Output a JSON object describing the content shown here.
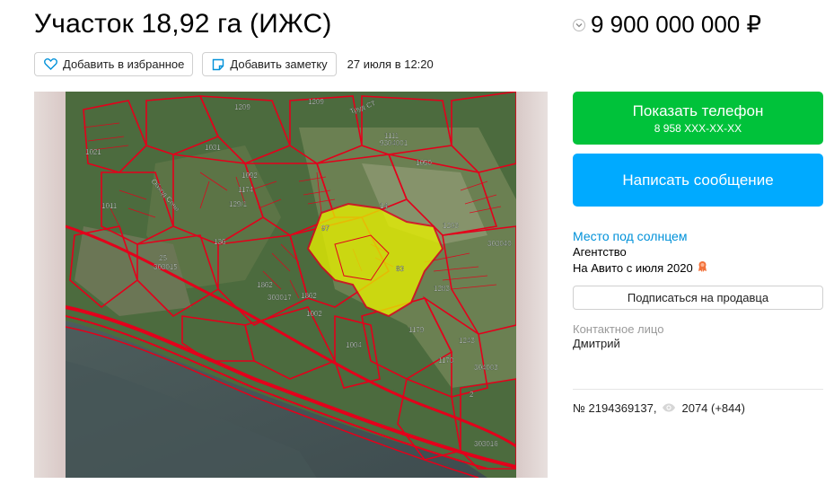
{
  "listing": {
    "title": "Участок 18,92 га (ИЖС)",
    "price": "9 900 000 000 ₽",
    "date": "27 июля в 12:20"
  },
  "actions": {
    "favorite_label": "Добавить в избранное",
    "note_label": "Добавить заметку"
  },
  "contact": {
    "phone_button_label": "Показать телефон",
    "phone_masked": "8 958 XXX-XX-XX",
    "message_button_label": "Написать сообщение"
  },
  "seller": {
    "name": "Место под солнцем",
    "type": "Агентство",
    "since": "На Авито с июля 2020",
    "subscribe_label": "Подписаться на продавца",
    "contact_label": "Контактное лицо",
    "contact_person": "Дмитрий"
  },
  "meta": {
    "number": "№ 2194369137,",
    "views": "2074 (+844)"
  },
  "map_labels": {
    "l1": "1209",
    "l2": "1209",
    "l3": "1111",
    "l4": "1021",
    "l5": "1031",
    "l6": "1092",
    "l7": "1174",
    "l8": "129/1",
    "l9": "14",
    "l10": "1050",
    "l11": "1203",
    "l12": "9304001",
    "l13": "303040",
    "l14": "97",
    "l15": "136",
    "l16": "25",
    "l17": "303015",
    "l18": "1862",
    "l19": "303017",
    "l20": "1862",
    "l21": "1283",
    "l22": "1002",
    "l23": "1004",
    "l24": "1243",
    "l25": "1170",
    "l26": "304003",
    "l27": "2",
    "l28": "303016",
    "l29": "1011",
    "l30": "83",
    "l31": "1179",
    "l32": "Обход Сочи",
    "l33": "Труд СТ"
  },
  "colors": {
    "accent_green": "#00c23a",
    "accent_blue": "#00aaff",
    "link": "#0091d9",
    "plot_highlight": "#e6f000",
    "boundary_red": "#e3001b"
  },
  "icons": {
    "favorite": "heart-icon",
    "note": "note-icon",
    "price_toggle": "chevron-down-icon",
    "badge": "medal-icon",
    "views": "eye-icon"
  }
}
